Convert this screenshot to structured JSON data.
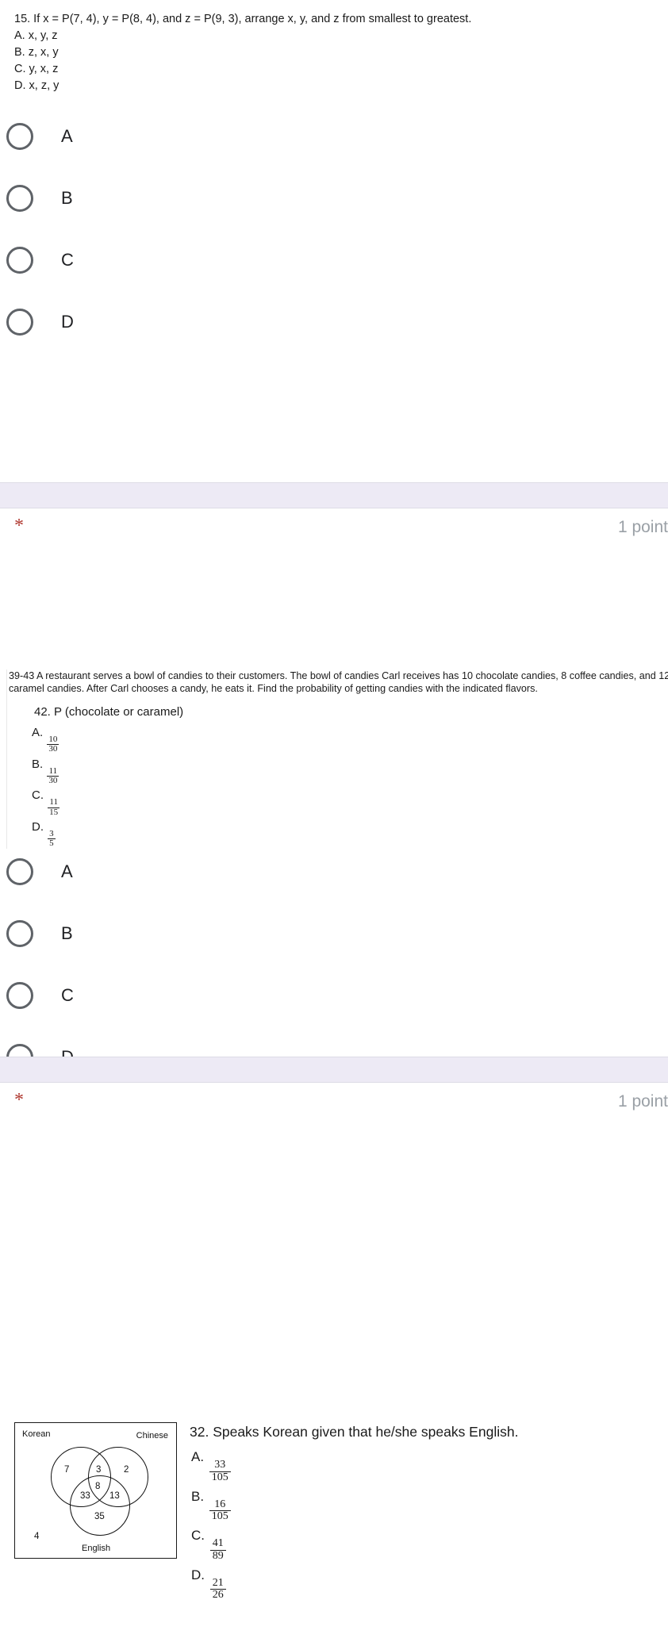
{
  "form": {
    "required_marker": "*",
    "points_label": "1 point"
  },
  "question_1": {
    "prompt": "15. If x = P(7, 4), y = P(8, 4), and z = P(9, 3), arrange x, y, and z from smallest to greatest.",
    "printed_choices": [
      "A. x, y, z",
      "B. z, x, y",
      "C. y, x, z",
      "D. x, z, y"
    ],
    "radio_options": [
      "A",
      "B",
      "C",
      "D"
    ]
  },
  "question_2": {
    "passage": "39-43 A restaurant serves a bowl of candies to their customers. The bowl of candies Carl receives has 10 chocolate candies, 8 coffee candies, and 12 caramel candies. After Carl chooses a candy, he eats it. Find the probability of getting candies with the indicated flavors.",
    "prompt": "42. P (chocolate or caramel)",
    "printed_choices": [
      {
        "letter": "A.",
        "num": "10",
        "den": "30"
      },
      {
        "letter": "B.",
        "num": "11",
        "den": "30"
      },
      {
        "letter": "C.",
        "num": "11",
        "den": "15"
      },
      {
        "letter": "D.",
        "num": "3",
        "den": "5"
      }
    ],
    "radio_options": [
      "A",
      "B",
      "C",
      "D"
    ]
  },
  "question_3": {
    "prompt": "32. Speaks Korean given that he/she speaks English.",
    "printed_choices": [
      {
        "letter": "A.",
        "num": "33",
        "den": "105"
      },
      {
        "letter": "B.",
        "num": "16",
        "den": "105"
      },
      {
        "letter": "C.",
        "num": "41",
        "den": "89"
      },
      {
        "letter": "D.",
        "num": "21",
        "den": "26"
      }
    ],
    "venn": {
      "label_korean": "Korean",
      "label_chinese": "Chinese",
      "label_english": "English",
      "korean_only": "7",
      "korean_chinese": "3",
      "chinese_only": "2",
      "center_all": "8",
      "korean_english": "33",
      "chinese_english": "13",
      "english_only": "35",
      "outside": "4"
    }
  }
}
